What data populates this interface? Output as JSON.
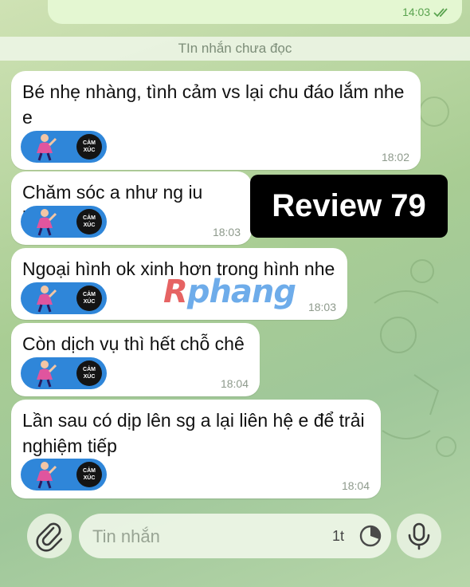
{
  "top_message": {
    "time": "14:03"
  },
  "unread_divider": "TIn nhắn chưa đọc",
  "messages": [
    {
      "text": "Bé nhẹ nhàng, tình cảm vs lại chu đáo lắm nhe e",
      "time": "18:02"
    },
    {
      "text": "Chăm sóc a như ng iu luôn",
      "time": "18:03"
    },
    {
      "text": "Ngoại hình ok xinh hơn trong hình nhe",
      "time": "18:03"
    },
    {
      "text": "Còn dịch vụ thì hết chỗ chê",
      "time": "18:04"
    },
    {
      "text": "Lần sau có dịp lên sg a lại liên hệ e để trải nghiệm tiếp",
      "time": "18:04"
    }
  ],
  "sticker": {
    "line1": "CẢM",
    "line2": "XÚC"
  },
  "overlay": {
    "review_label": "Review 79",
    "watermark_first": "R",
    "watermark_rest": "phang"
  },
  "composer": {
    "placeholder": "Tin nhắn",
    "counter": "1t"
  },
  "icons": {
    "attach": "paperclip-icon",
    "timer": "timer-icon",
    "mic": "microphone-icon",
    "read": "double-check-icon"
  },
  "colors": {
    "bubble_out": "#e4f7d2",
    "bubble_in": "#ffffff",
    "time_out": "#5aa34f",
    "sticker_blue": "#2f86d9"
  }
}
